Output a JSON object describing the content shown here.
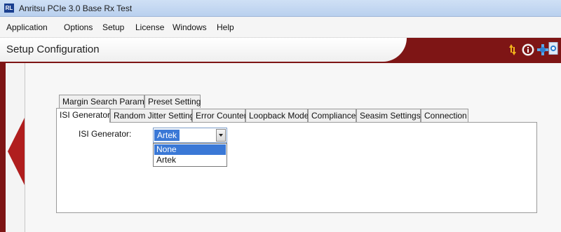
{
  "window": {
    "title": "Anritsu PCIe 3.0 Base Rx Test",
    "app_icon_text": "RL"
  },
  "menu": {
    "items": [
      "Application",
      "Options",
      "Setup",
      "License",
      "Windows",
      "Help"
    ]
  },
  "header": {
    "title": "Setup Configuration",
    "icons": [
      "transfer-arrows-icon",
      "info-icon",
      "network-icon",
      "camera-icon"
    ],
    "accent_color": "#7e1515"
  },
  "tabs": {
    "row1": [
      "Margin Search Params",
      "Preset Setting"
    ],
    "row2": [
      "ISI Generator",
      "Random Jitter Setting",
      "Error Counter",
      "Loopback Mode",
      "Compliance",
      "Seasim Settings",
      "Connection"
    ],
    "active": "ISI Generator"
  },
  "isi": {
    "label": "ISI Generator:",
    "selected": "Artek",
    "options": [
      "None",
      "Artek"
    ],
    "highlighted_option": "None"
  }
}
